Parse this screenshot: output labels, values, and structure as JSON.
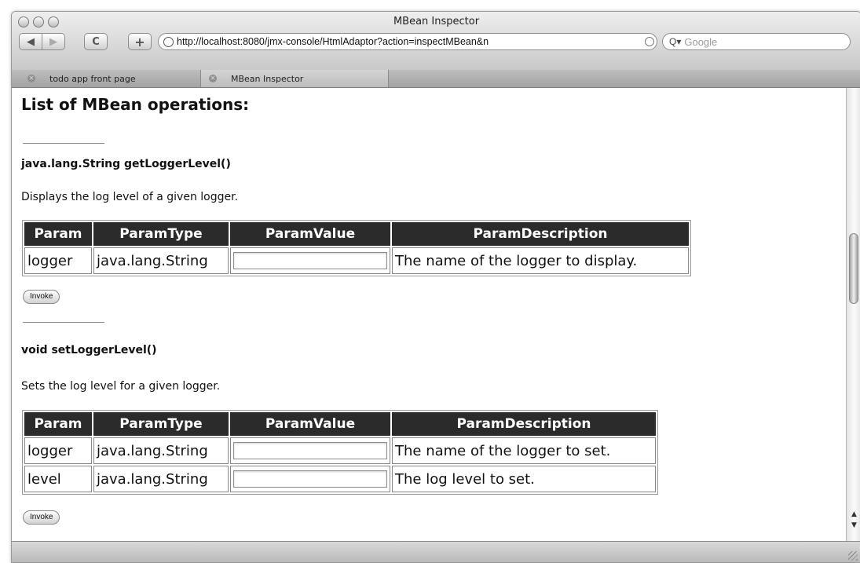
{
  "window": {
    "title": "MBean Inspector"
  },
  "toolbar": {
    "back_icon": "back-arrow-icon",
    "forward_icon": "forward-arrow-icon",
    "reload_label": "C",
    "add_label": "+",
    "url": "http://localhost:8080/jmx-console/HtmlAdaptor?action=inspectMBean&n",
    "search_placeholder": "Google"
  },
  "tabs": [
    {
      "label": "todo app front page"
    },
    {
      "label": "MBean Inspector"
    }
  ],
  "page": {
    "heading": "List of MBean operations:",
    "operations": [
      {
        "signature": "java.lang.String getLoggerLevel()",
        "description": "Displays the log level of a given logger.",
        "headers": [
          "Param",
          "ParamType",
          "ParamValue",
          "ParamDescription"
        ],
        "rows": [
          {
            "param": "logger",
            "type": "java.lang.String",
            "value": "",
            "description": "The name of the logger to display."
          }
        ],
        "invoke_label": "Invoke"
      },
      {
        "signature": "void setLoggerLevel()",
        "description": "Sets the log level for a given logger.",
        "headers": [
          "Param",
          "ParamType",
          "ParamValue",
          "ParamDescription"
        ],
        "rows": [
          {
            "param": "logger",
            "type": "java.lang.String",
            "value": "",
            "description": "The name of the logger to set."
          },
          {
            "param": "level",
            "type": "java.lang.String",
            "value": "",
            "description": "The log level to set."
          }
        ],
        "invoke_label": "Invoke"
      }
    ]
  },
  "colors": {
    "table_header_bg": "#2b2b2b",
    "table_header_text": "#ffffff"
  }
}
